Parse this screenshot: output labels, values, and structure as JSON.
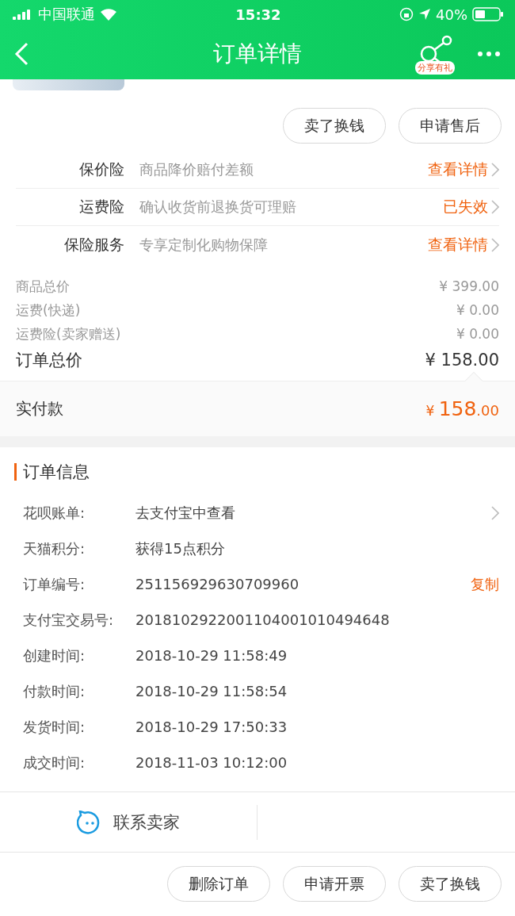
{
  "status_bar": {
    "carrier": "中国联通",
    "time": "15:32",
    "battery": "40%"
  },
  "nav": {
    "title": "订单详情",
    "share_badge": "分享有礼"
  },
  "top_buttons": [
    "卖了换钱",
    "申请售后"
  ],
  "insurance": [
    {
      "label": "保价险",
      "desc": "商品降价赔付差额",
      "link": "查看详情"
    },
    {
      "label": "运费险",
      "desc": "确认收货前退换货可理赔",
      "link": "已失效"
    },
    {
      "label": "保险服务",
      "desc": "专享定制化购物保障",
      "link": "查看详情"
    }
  ],
  "prices": [
    {
      "label": "商品总价",
      "value": "¥ 399.00"
    },
    {
      "label": "运费(快递)",
      "value": "¥ 0.00"
    },
    {
      "label": "运费险(卖家赠送)",
      "value": "¥ 0.00"
    }
  ],
  "total": {
    "label": "订单总价",
    "value": "¥ 158.00"
  },
  "paid": {
    "label": "实付款",
    "currency": "¥",
    "integer": "158",
    "decimal": ".00"
  },
  "order_info": {
    "title": "订单信息",
    "rows": [
      {
        "label": "花呗账单:",
        "value": "去支付宝中查看",
        "chevron": true
      },
      {
        "label": "天猫积分:",
        "value": "获得15点积分",
        "chevron": false
      },
      {
        "label": "订单编号:",
        "value": "251156929630709960",
        "chevron": false,
        "action": "复制"
      },
      {
        "label": "支付宝交易号:",
        "value": "2018102922001104001010494648",
        "chevron": false
      },
      {
        "label": "创建时间:",
        "value": "2018-10-29 11:58:49",
        "chevron": false
      },
      {
        "label": "付款时间:",
        "value": "2018-10-29 11:58:54",
        "chevron": false
      },
      {
        "label": "发货时间:",
        "value": "2018-10-29 17:50:33",
        "chevron": false
      },
      {
        "label": "成交时间:",
        "value": "2018-11-03 10:12:00",
        "chevron": false
      }
    ]
  },
  "contact": "联系卖家",
  "bottom_buttons": [
    "删除订单",
    "申请开票",
    "卖了换钱"
  ]
}
